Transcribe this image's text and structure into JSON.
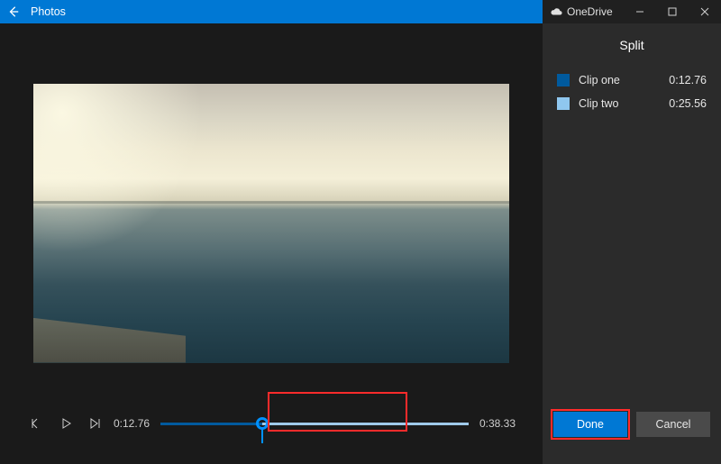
{
  "window": {
    "app_title": "Photos",
    "cloud_label": "OneDrive"
  },
  "panel": {
    "heading": "Split",
    "clips": [
      {
        "name": "Clip one",
        "duration": "0:12.76",
        "color": "#005a9e"
      },
      {
        "name": "Clip two",
        "duration": "0:25.56",
        "color": "#8fc7ef"
      }
    ]
  },
  "playback": {
    "current_time": "0:12.76",
    "total_time": "0:38.33",
    "split_fraction": 0.33
  },
  "actions": {
    "done_label": "Done",
    "cancel_label": "Cancel"
  },
  "colors": {
    "accent": "#0078d4",
    "danger_highlight": "#ff2b2b"
  }
}
